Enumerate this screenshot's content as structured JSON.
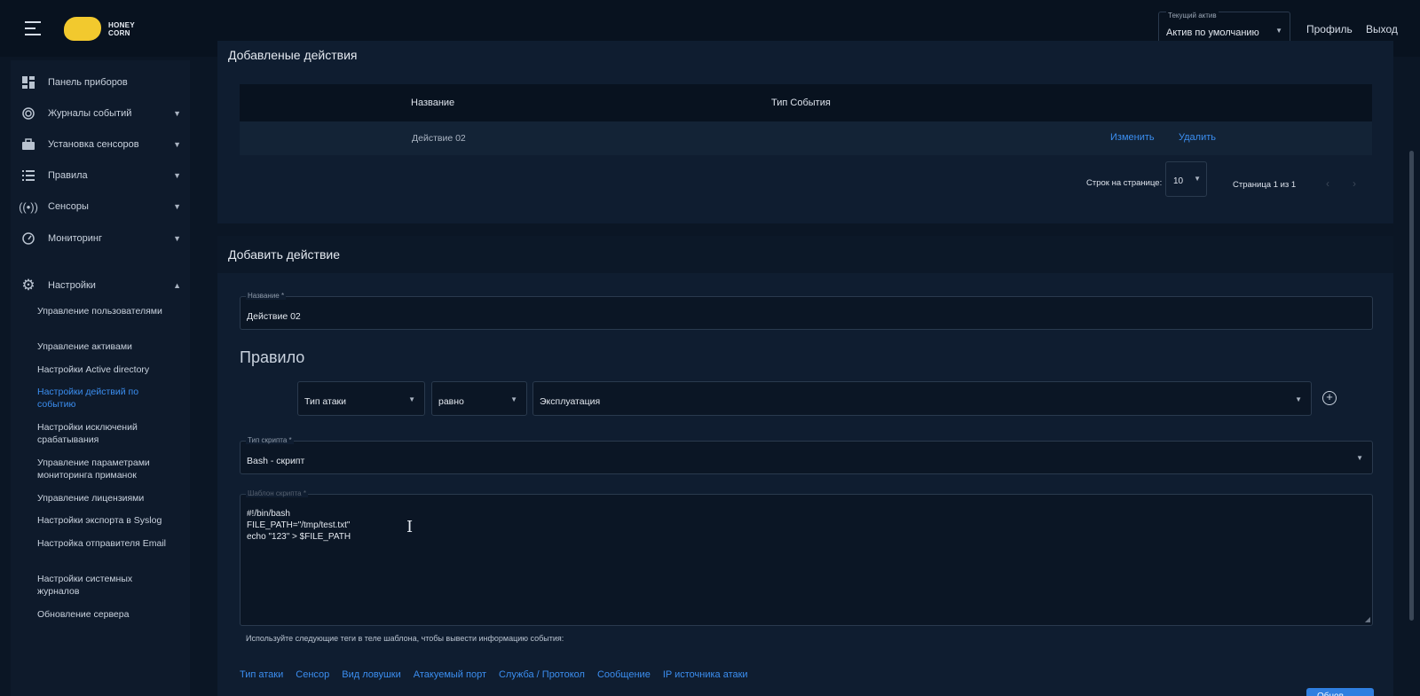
{
  "header": {
    "logo_line1": "HONEY",
    "logo_line2": "CORN",
    "asset_label": "Текущий актив",
    "asset_value": "Актив по умолчанию",
    "profile": "Профиль",
    "logout": "Выход"
  },
  "sidebar": {
    "items": [
      {
        "label": "Панель приборов",
        "icon": "dashboard-icon"
      },
      {
        "label": "Журналы событий",
        "icon": "target-icon"
      },
      {
        "label": "Установка сенсоров",
        "icon": "toolbox-icon"
      },
      {
        "label": "Правила",
        "icon": "list-icon"
      },
      {
        "label": "Сенсоры",
        "icon": "broadcast-icon"
      },
      {
        "label": "Мониторинг",
        "icon": "gauge-icon"
      },
      {
        "label": "Настройки",
        "icon": "gear-icon"
      }
    ],
    "sub_items": [
      "Управление пользователями",
      "Управление активами",
      "Настройки Active directory",
      "Настройки действий по событию",
      "Настройки исключений срабатывания",
      "Управление параметрами мониторинга приманок",
      "Управление лицензиями",
      "Настройки экспорта в Syslog",
      "Настройка отправителя Email",
      "Настройки системных журналов",
      "Обновление сервера"
    ]
  },
  "added_actions": {
    "title": "Добавленые действия",
    "columns": [
      "Название",
      "Тип События"
    ],
    "rows": [
      {
        "name": "Действие 02",
        "event_type": "",
        "edit": "Изменить",
        "delete": "Удалить"
      }
    ],
    "rows_per_page_label": "Строк на странице:",
    "rows_per_page": "10",
    "page_info": "Страница 1 из 1"
  },
  "add_action": {
    "title": "Добавить действие",
    "name_label": "Название *",
    "name_value": "Действие 02",
    "rule_title": "Правило",
    "rule": {
      "field": "Тип атаки",
      "operator": "равно",
      "value": "Эксплуатация"
    },
    "script_type_label": "Тип скрипта *",
    "script_type_value": "Bash - скрипт",
    "template_label": "Шаблон скрипта *",
    "script_lines": [
      "#!/bin/bash",
      "FILE_PATH=\"/tmp/test.txt\"",
      "echo \"123\" > $FILE_PATH"
    ],
    "hint": "Используйте следующие теги в теле шаблона, чтобы вывести информацию события:",
    "tags": [
      "Тип атаки",
      "Сенсор",
      "Вид ловушки",
      "Атакуемый порт",
      "Служба / Протокол",
      "Сообщение",
      "IP источника атаки"
    ],
    "submit": "Обнов"
  }
}
